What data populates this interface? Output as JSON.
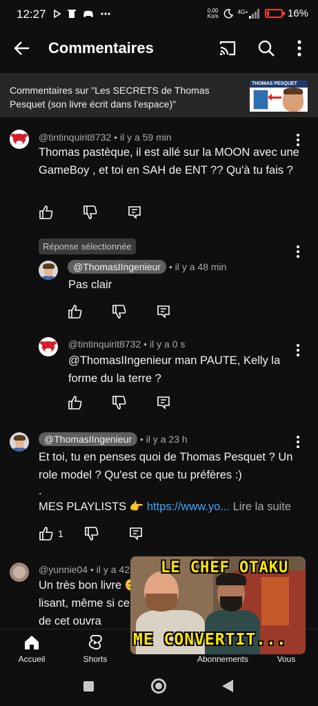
{
  "status_bar": {
    "time": "12:27",
    "net_speed_value": "0,00",
    "net_speed_unit": "Ko/s",
    "network": "4G+",
    "battery_text": "16%",
    "battery_level": 0.16,
    "battery_color": "#ff3b30"
  },
  "app_bar": {
    "title": "Commentaires",
    "icons": [
      "back-arrow-icon",
      "cast-icon",
      "search-icon",
      "more-vert-icon"
    ]
  },
  "video": {
    "caption": "Commentaires sur \"Les SECRETS de Thomas Pesquet (son livre écrit dans l'espace)\"",
    "thumbnail_label": "THOMAS PESQUET"
  },
  "comments": [
    {
      "author": "@tintinquirit8732",
      "time": " • il y a 59 min",
      "text": "Thomas pastèque, il est allé sur la MOON avec une GameBoy , et toi en SAH de ENT ?? Qu'à tu fais ?",
      "likes": ""
    },
    {
      "selected_label": "Réponse sélectionnée",
      "author": "@ThomasIIngenieur",
      "time": " • il y a 48 min",
      "text": "Pas clair",
      "likes": ""
    },
    {
      "author": "@tintinquirit8732",
      "time": " • il y a 0 s",
      "text": "@ThomasIIngenieur  man PAUTE, Kelly la forme du la terre ?",
      "likes": ""
    },
    {
      "author": "@ThomasIIngenieur",
      "time": " • il y a 23 h",
      "text_line1": "Et toi, tu en penses quoi de Thomas Pesquet ? Un role model ? Qu'est ce que tu préfères :)",
      "text_dot": ".",
      "text_playlists": "MES PLAYLISTS 👉 ",
      "link": "https://www.yo...",
      "read_more": " Lire la suite",
      "likes": "1"
    },
    {
      "author": "@yunnie04",
      "time": " • il y a 42",
      "text": "Un très bon livre 😊 lisant, même si ce initial de cet ouvra"
    }
  ],
  "mini_player": {
    "caption_top": "LE CHEF OTAKU",
    "caption_bottom": "ME CONVERTIT..."
  },
  "bottom_nav": [
    {
      "label": "Accueil",
      "icon": "home-icon"
    },
    {
      "label": "Shorts",
      "icon": "shorts-icon"
    },
    {
      "label": "Abonnements",
      "icon": "subscriptions-icon"
    },
    {
      "label": "Vous",
      "icon": "you-icon"
    }
  ]
}
